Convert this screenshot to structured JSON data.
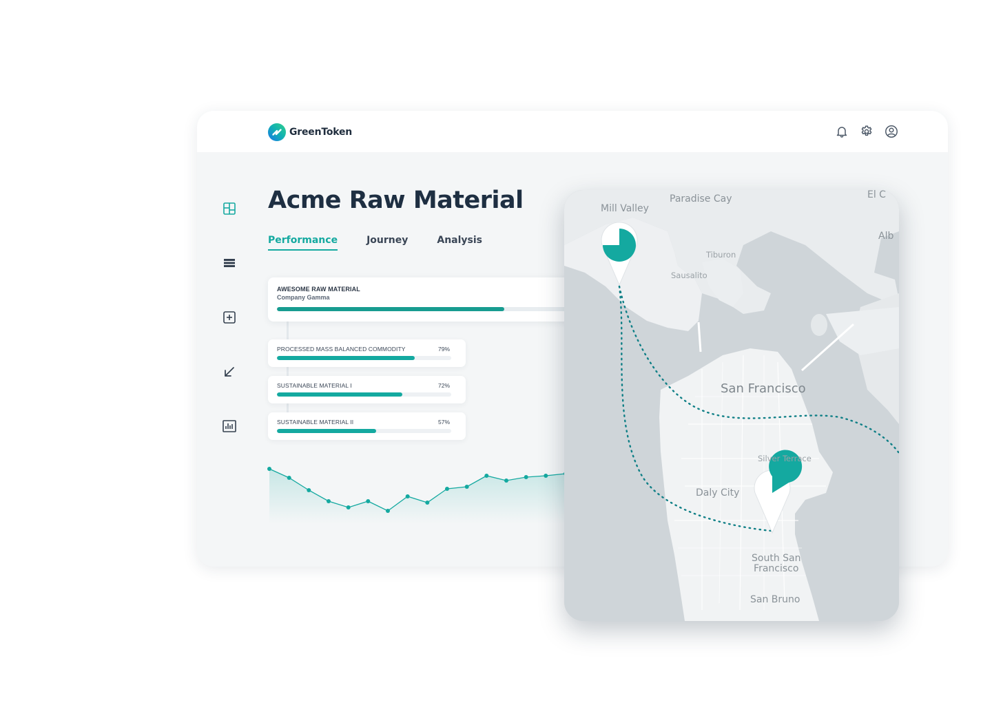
{
  "app": {
    "brand": "GreenToken",
    "accent_color": "#14a9a0"
  },
  "header": {
    "icons": [
      "bell-icon",
      "gear-icon",
      "user-circle-icon"
    ]
  },
  "sidebar": {
    "items": [
      "dashboard-icon",
      "list-icon",
      "add-box-icon",
      "arrow-down-left-icon",
      "bar-chart-icon"
    ]
  },
  "page": {
    "title": "Acme Raw Material"
  },
  "tabs": [
    {
      "label": "Performance",
      "active": true
    },
    {
      "label": "Journey",
      "active": false
    },
    {
      "label": "Analysis",
      "active": false
    }
  ],
  "main_material": {
    "title": "AWESOME RAW MATERIAL",
    "company": "Company Gamma",
    "progress_pct": 75
  },
  "components": [
    {
      "label": "PROCESSED MASS BALANCED COMMODITY",
      "percent": "79%",
      "value": 79
    },
    {
      "label": "SUSTAINABLE MATERIAL I",
      "percent": "72%",
      "value": 72
    },
    {
      "label": "SUSTAINABLE MATERIAL II",
      "percent": "57%",
      "value": 57
    }
  ],
  "chart_data": {
    "type": "area",
    "title": "",
    "xlabel": "",
    "ylabel": "",
    "x": [
      1,
      2,
      3,
      4,
      5,
      6,
      7,
      8,
      9,
      10,
      11,
      12,
      13,
      14,
      15,
      16
    ],
    "values": [
      80,
      67,
      49,
      33,
      24,
      33,
      19,
      40,
      31,
      51,
      54,
      70,
      63,
      68,
      70,
      73
    ],
    "ylim": [
      0,
      100
    ],
    "grid": false,
    "line_color": "#14a9a0"
  },
  "map": {
    "labels": {
      "mill_valley": "Mill Valley",
      "paradise_cay": "Paradise Cay",
      "el": "El C",
      "alb": "Alb",
      "tiburon": "Tiburon",
      "sausalito": "Sausalito",
      "san_francisco": "San Francisco",
      "silver_terrace": "Silver Terrace",
      "daly_city": "Daly City",
      "south_sf_line1": "South San",
      "south_sf_line2": "Francisco",
      "san_bruno": "San Bruno"
    },
    "pins": [
      {
        "name": "pin-north",
        "fill_fraction": 0.75
      },
      {
        "name": "pin-south",
        "fill_fraction": 0.85
      }
    ],
    "route_color": "#0f7f86"
  }
}
